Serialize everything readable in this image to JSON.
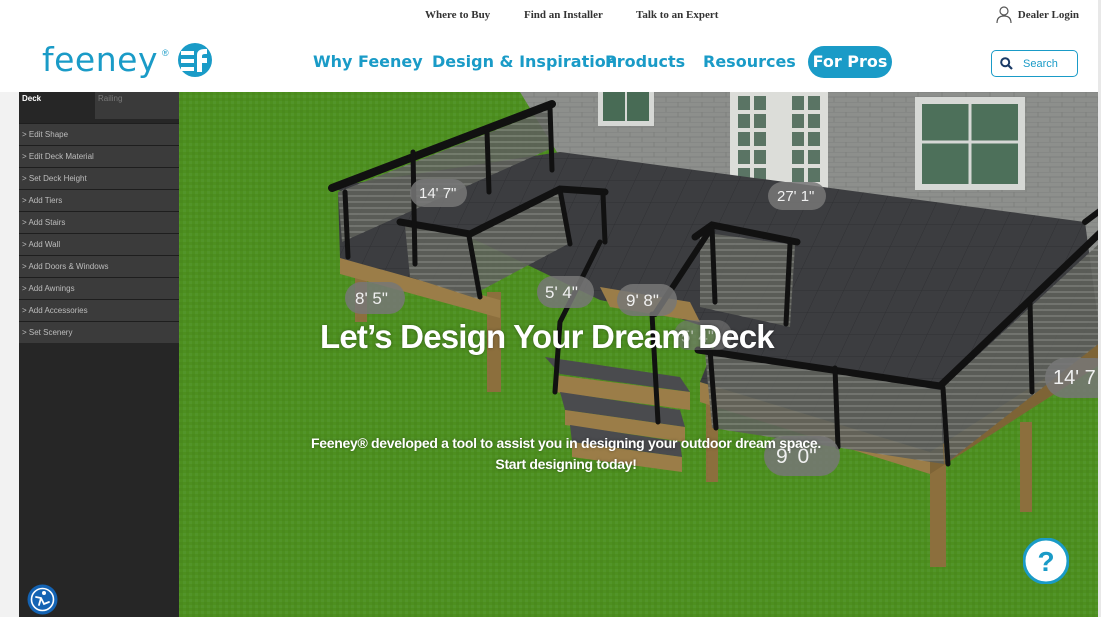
{
  "utility_bar": {
    "where_to_buy": "Where to Buy",
    "find_installer": "Find an Installer",
    "talk_expert": "Talk to an Expert",
    "dealer_login": "Dealer Login"
  },
  "nav": {
    "logo": "feeney",
    "logo_reg": "®",
    "items": [
      "Why Feeney",
      "Design & Inspiration",
      "Products",
      "Resources"
    ],
    "for_pros": "For Pros",
    "search_label": "Search"
  },
  "colors": {
    "brand": "#1a9bc7",
    "grass": "#4d8f1f",
    "deck": "#3d3d40",
    "sidebar": "#262626"
  },
  "tool": {
    "tabs": [
      "Deck",
      "Railing"
    ],
    "menu": [
      "> Edit Shape",
      "> Edit Deck Material",
      "> Set Deck Height",
      "> Add Tiers",
      "> Add Stairs",
      "> Add Wall",
      "> Add Doors & Windows",
      "> Add Awnings",
      "> Add Accessories",
      "> Set Scenery"
    ],
    "dimensions": [
      "14' 7\"",
      "27' 1\"",
      "8' 5\"",
      "5' 4\"",
      "9' 8\"",
      "5' 4\"",
      "14' 7",
      "9' 0\""
    ]
  },
  "hero": {
    "title": "Let’s Design Your Dream Deck",
    "subtitle_line1": "Feeney® developed a tool to assist you in designing your outdoor dream space.",
    "subtitle_line2": "Start designing today!"
  },
  "icons": {
    "user": "user-icon",
    "search": "search-icon",
    "accessibility": "accessibility-icon",
    "help": "help-icon"
  },
  "help": {
    "label": "?"
  }
}
